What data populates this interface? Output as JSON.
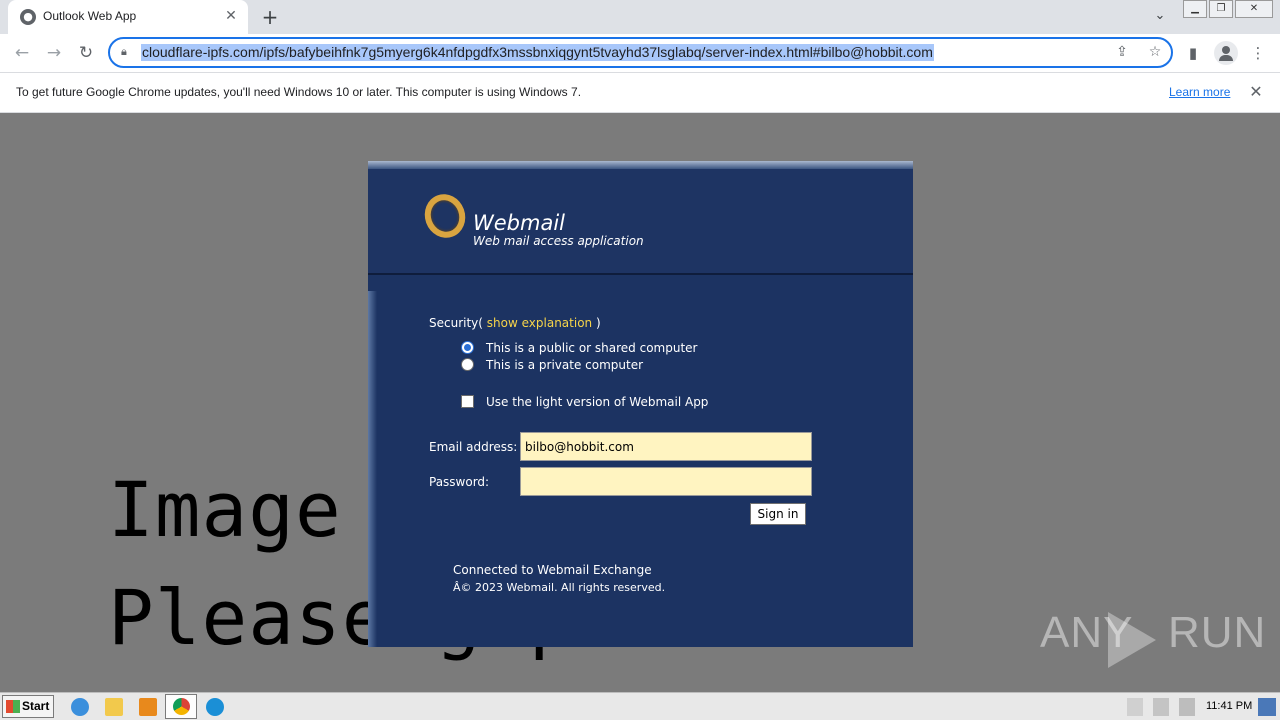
{
  "browser": {
    "tab_title": "Outlook Web App",
    "url": "cloudflare-ipfs.com/ipfs/bafybeihfnk7g5myerg6k4nfdpgdfx3mssbnxiqgynt5tvayhd37lsglabq/server-index.html#bilbo@hobbit.com",
    "infobar": {
      "message": "To get future Google Chrome updates, you'll need Windows 10 or later. This computer is using Windows 7.",
      "learn_more": "Learn more"
    }
  },
  "background_text": {
    "line1": "Image           ed.",
    "line2": "Please      g    p"
  },
  "login": {
    "app_title": "Webmail",
    "app_subtitle": "Web mail access application",
    "security_label": "Security(",
    "show_explanation": "show explanation",
    "security_close": ")",
    "radio_public": "This is a public or shared computer",
    "radio_private": "This is a private computer",
    "light_version": "Use the light version of Webmail App",
    "email_label": "Email address:",
    "email_value": "bilbo@hobbit.com",
    "password_label": "Password:",
    "password_value": "",
    "sign_in": "Sign in",
    "connected": "Connected to Webmail Exchange",
    "copyright": "Â© 2023 Webmail. All rights reserved."
  },
  "watermark": {
    "left": "ANY",
    "right": "RUN"
  },
  "taskbar": {
    "start": "Start",
    "clock": "11:41 PM"
  }
}
